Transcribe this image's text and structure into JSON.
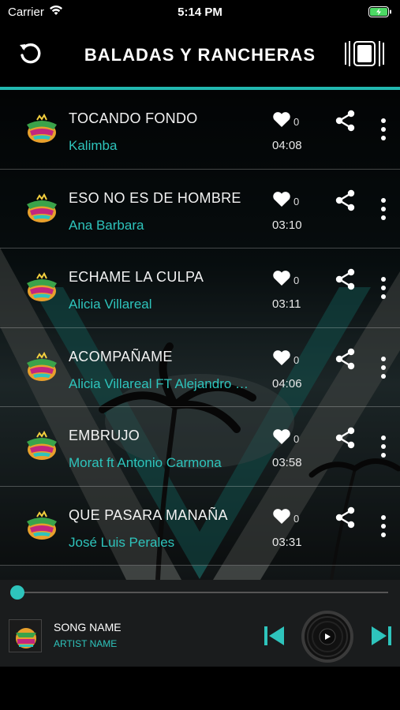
{
  "status_bar": {
    "carrier": "Carrier",
    "time": "5:14 PM"
  },
  "nav": {
    "title": "BALADAS Y RANCHERAS",
    "back_icon": "refresh-back-icon",
    "player_icon": "now-playing-icon"
  },
  "colors": {
    "accent": "#2ec4bc",
    "background": "#000000",
    "player_bg": "#1a1c1d"
  },
  "songs": [
    {
      "title": "TOCANDO FONDO",
      "artist": "Kalimba",
      "likes": "0",
      "duration": "04:08"
    },
    {
      "title": "ESO NO ES DE HOMBRE",
      "artist": "Ana Barbara",
      "likes": "0",
      "duration": "03:10"
    },
    {
      "title": "ECHAME  LA CULPA",
      "artist": "Alicia Villareal",
      "likes": "0",
      "duration": "03:11"
    },
    {
      "title": "ACOMPAÑAME",
      "artist": "Alicia Villareal FT Alejandro Fernandez",
      "likes": "0",
      "duration": "04:06"
    },
    {
      "title": "EMBRUJO",
      "artist": "Morat ft Antonio Carmona",
      "likes": "0",
      "duration": "03:58"
    },
    {
      "title": "QUE PASARA MANAÑA",
      "artist": "José Luis Perales",
      "likes": "0",
      "duration": "03:31"
    }
  ],
  "player": {
    "song_name": "SONG NAME",
    "artist_name": "ARTIST NAME",
    "progress": 0
  }
}
